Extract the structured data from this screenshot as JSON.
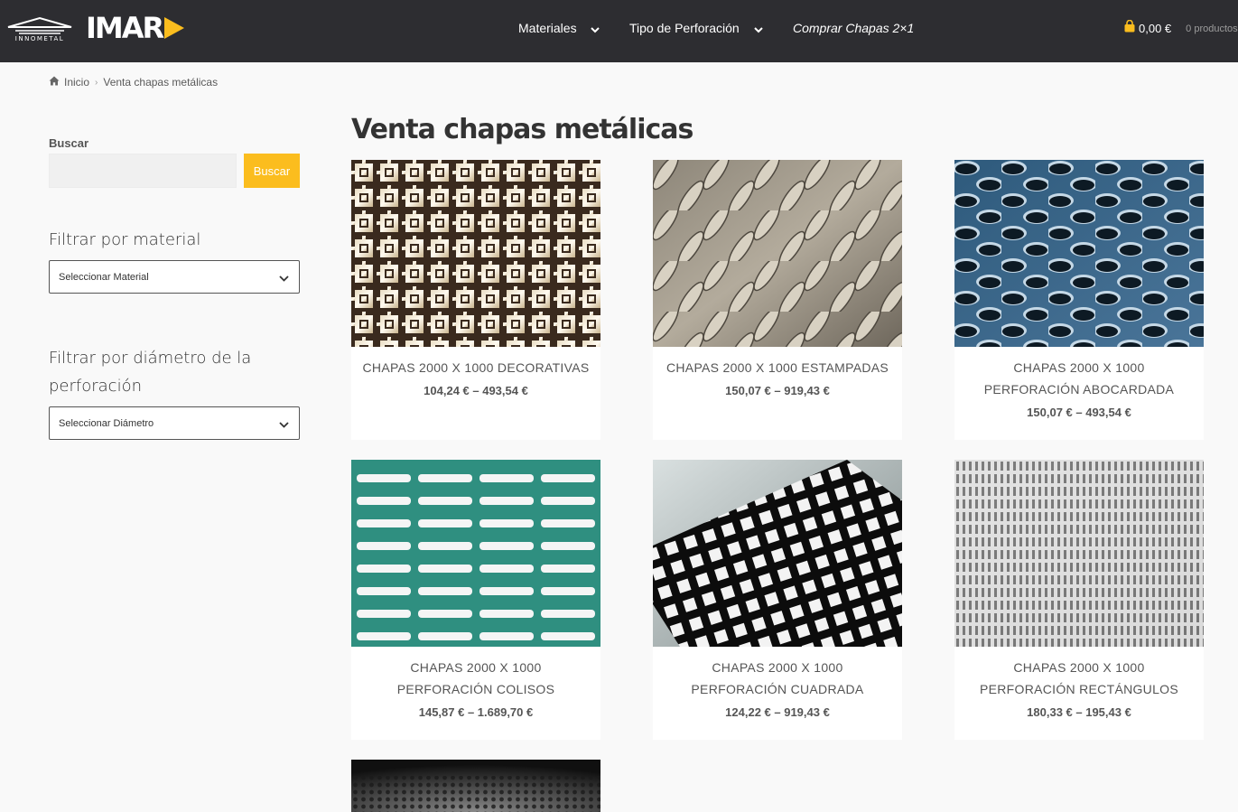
{
  "brand": {
    "innometal": "INNOMETAL",
    "imar": "IMAR"
  },
  "nav": [
    {
      "label": "Materiales"
    },
    {
      "label": "Tipo de Perforación"
    },
    {
      "label": "Comprar Chapas 2×1"
    }
  ],
  "cart": {
    "amount": "0,00 €",
    "count": "0 productos"
  },
  "breadcrumb": {
    "home": "Inicio",
    "current": "Venta chapas metálicas"
  },
  "sidebar": {
    "search_label": "Buscar",
    "search_value": "",
    "search_button": "Buscar",
    "filter_material_title": "Filtrar por material",
    "filter_material_select": "Seleccionar Material",
    "filter_diameter_title": "Filtrar por diámetro de la perforación",
    "filter_diameter_select": "Seleccionar Diámetro"
  },
  "page_title": "Venta chapas metálicas",
  "products": [
    {
      "name": "CHAPAS 2000 X 1000 DECORATIVAS",
      "price": "104,24 € – 493,54 €"
    },
    {
      "name": "CHAPAS 2000 X 1000 ESTAMPADAS",
      "price": "150,07 € – 919,43 €"
    },
    {
      "name": "CHAPAS 2000 X 1000 PERFORACIÓN ABOCARDADA",
      "price": "150,07 € – 493,54 €"
    },
    {
      "name": "CHAPAS 2000 X 1000 PERFORACIÓN COLISOS",
      "price": "145,87 € – 1.689,70 €"
    },
    {
      "name": "CHAPAS 2000 X 1000 PERFORACIÓN CUADRADA",
      "price": "124,22 € – 919,43 €"
    },
    {
      "name": "CHAPAS 2000 X 1000 PERFORACIÓN RECTÁNGULOS",
      "price": "180,33 € – 195,43 €"
    }
  ],
  "colors": {
    "header": "#2d2d31",
    "accent": "#fbbd1e",
    "background": "#f9f9f9"
  },
  "icons": [
    "home-icon",
    "cart-icon",
    "chevron-down-icon"
  ]
}
